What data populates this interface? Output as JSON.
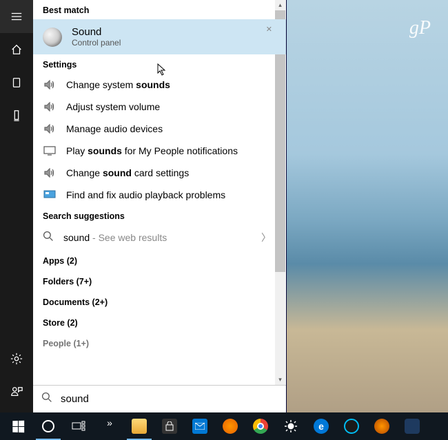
{
  "watermark": "gP",
  "sections": {
    "best_match": "Best match",
    "settings": "Settings",
    "suggestions": "Search suggestions"
  },
  "best_match": {
    "title": "Sound",
    "subtitle": "Control panel"
  },
  "settings_items": [
    {
      "pre": "Change system ",
      "bold": "sounds",
      "post": ""
    },
    {
      "pre": "Adjust system volume",
      "bold": "",
      "post": ""
    },
    {
      "pre": "Manage audio devices",
      "bold": "",
      "post": ""
    },
    {
      "pre": "Play ",
      "bold": "sounds",
      "post": " for My People notifications"
    },
    {
      "pre": "Change ",
      "bold": "sound",
      "post": " card settings"
    },
    {
      "pre": "Find and fix audio playback problems",
      "bold": "",
      "post": ""
    }
  ],
  "suggestion": {
    "term": "sound",
    "hint": " - See web results"
  },
  "categories": [
    {
      "label": "Apps",
      "count": "(2)"
    },
    {
      "label": "Folders",
      "count": "(7+)"
    },
    {
      "label": "Documents",
      "count": "(2+)"
    },
    {
      "label": "Store",
      "count": "(2)"
    },
    {
      "label": "People",
      "count": "(1+)"
    }
  ],
  "search": {
    "value": "sound"
  },
  "taskbar_icons": [
    "start",
    "cortana",
    "task-view",
    "expand",
    "file-explorer",
    "store",
    "mail",
    "firefox",
    "chrome",
    "brightness",
    "edge",
    "logitech",
    "firefox2",
    "x-app"
  ]
}
